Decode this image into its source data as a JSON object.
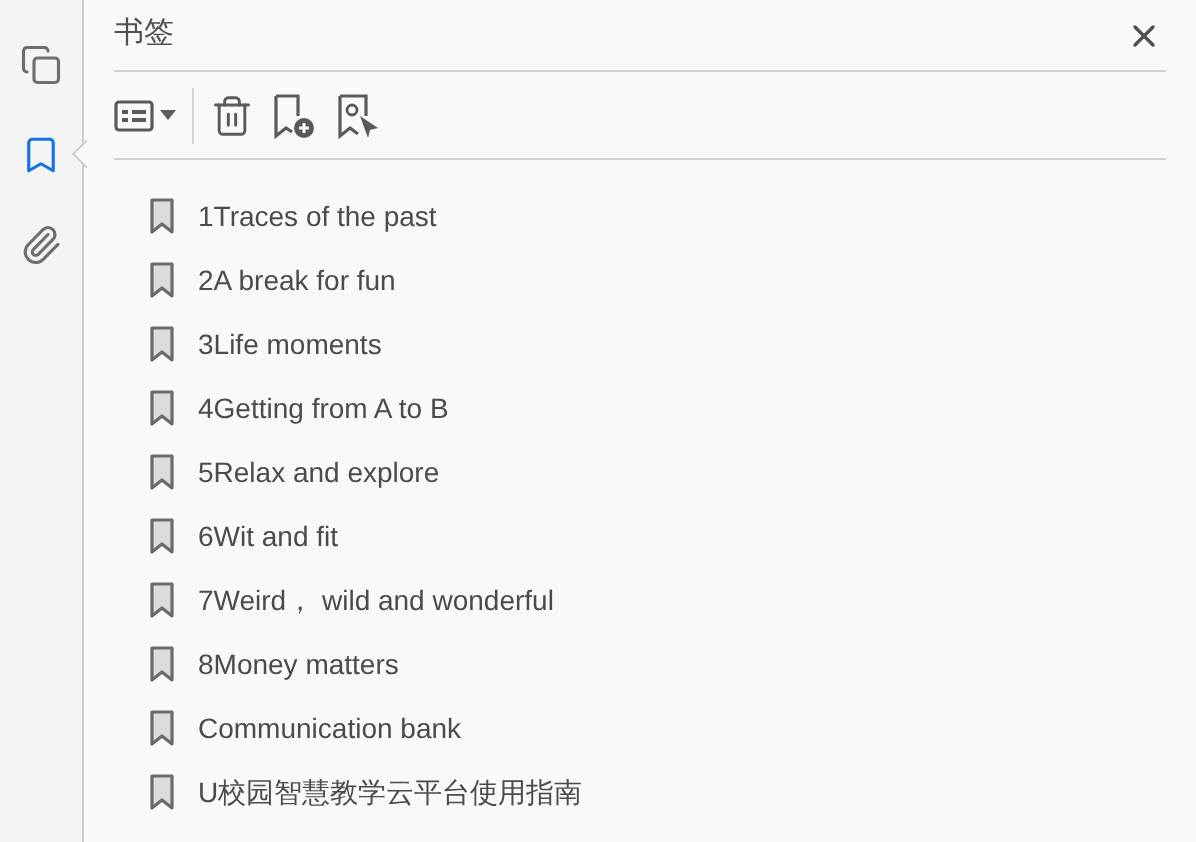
{
  "sidebar": {
    "items": [
      {
        "kind": "pages",
        "selected": false
      },
      {
        "kind": "bookmarks",
        "selected": true
      },
      {
        "kind": "attachments",
        "selected": false
      }
    ]
  },
  "panel": {
    "title": "书签"
  },
  "bookmarks": [
    {
      "label": "1Traces of the past"
    },
    {
      "label": "2A break for fun"
    },
    {
      "label": "3Life moments"
    },
    {
      "label": "4Getting from A to B"
    },
    {
      "label": "5Relax and explore"
    },
    {
      "label": "6Wit and fit"
    },
    {
      "label": "7Weird， wild and wonderful"
    },
    {
      "label": "8Money matters"
    },
    {
      "label": "Communication bank"
    },
    {
      "label": "U校园智慧教学云平台使用指南"
    }
  ]
}
